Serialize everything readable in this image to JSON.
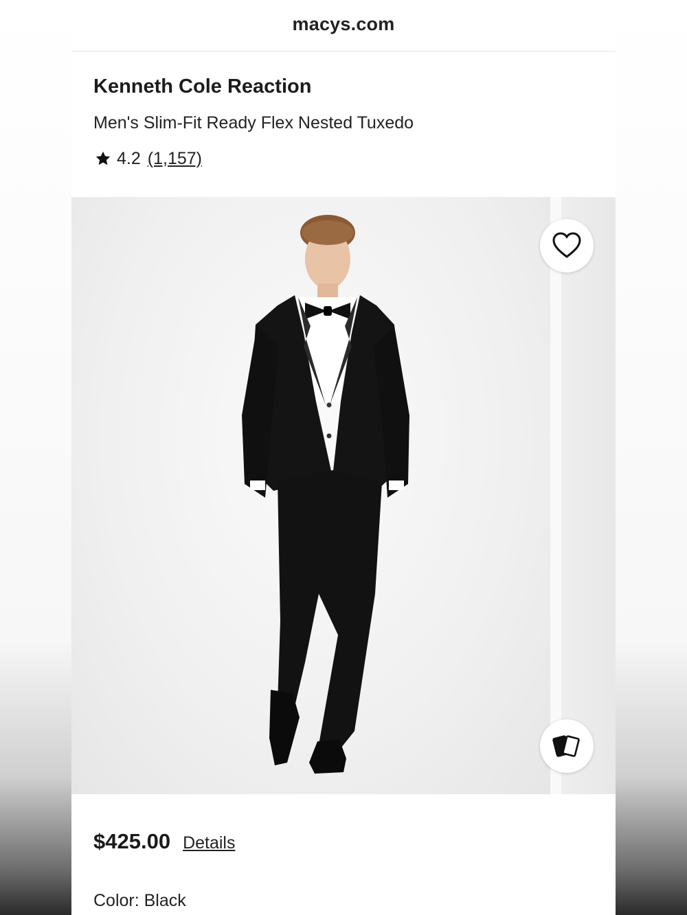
{
  "browser": {
    "url": "macys.com"
  },
  "product": {
    "brand": "Kenneth Cole Reaction",
    "name": "Men's Slim-Fit Ready Flex Nested Tuxedo",
    "rating": "4.2",
    "review_count": "(1,157)",
    "price": "$425.00",
    "details_label": "Details",
    "color_label": "Color: Black"
  },
  "icons": {
    "rating_star": "star-icon",
    "favorite": "heart-icon",
    "swatches": "cards-icon"
  },
  "colors": {
    "text": "#222222",
    "page_bg": "#ffffff",
    "gallery_bg": "#f2f2f2"
  }
}
